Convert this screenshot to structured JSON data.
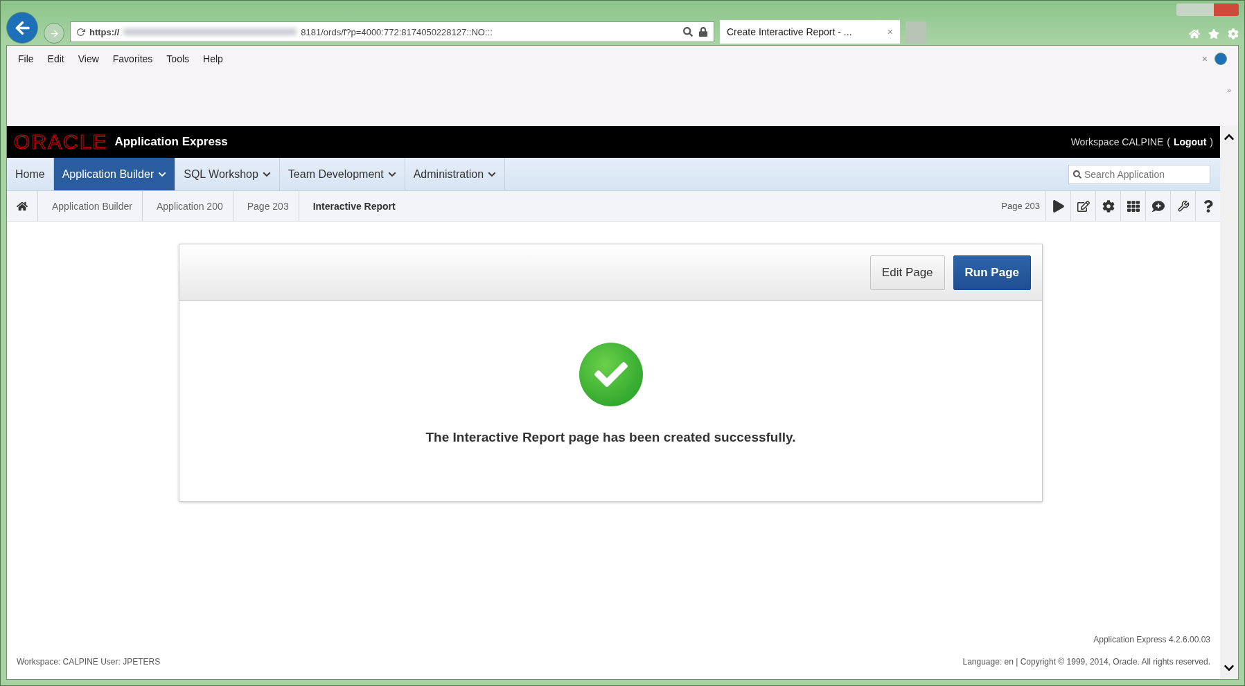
{
  "browser": {
    "url_scheme": "https://",
    "url_rest": "8181/ords/f?p=4000:772:8174050228127::NO:::",
    "tabs": [
      {
        "title": "Create Interactive Report - ...",
        "selected": true
      }
    ],
    "tab_close": "×",
    "menu": [
      "File",
      "Edit",
      "View",
      "Favorites",
      "Tools",
      "Help"
    ],
    "bar_close": "×",
    "chevron": "»"
  },
  "header": {
    "logo": "ORACLE",
    "product": "Application Express",
    "workspace": "Workspace CALPINE",
    "logout": "Logout",
    "paren_open": "(",
    "paren_close": ")"
  },
  "nav": [
    {
      "label": "Home",
      "selected": false,
      "dropdown": false
    },
    {
      "label": "Application Builder",
      "selected": true,
      "dropdown": true
    },
    {
      "label": "SQL Workshop",
      "selected": false,
      "dropdown": true
    },
    {
      "label": "Team Development",
      "selected": false,
      "dropdown": true
    },
    {
      "label": "Administration",
      "selected": false,
      "dropdown": true
    }
  ],
  "search": {
    "placeholder": "Search Application"
  },
  "breadcrumb": [
    {
      "label": "Application Builder",
      "current": false
    },
    {
      "label": "Application 200",
      "current": false
    },
    {
      "label": "Page 203",
      "current": false
    },
    {
      "label": "Interactive Report",
      "current": true
    }
  ],
  "page_label": "Page 203",
  "toolbar": [
    {
      "kind": "run"
    },
    {
      "kind": "edit"
    },
    {
      "kind": "settings"
    },
    {
      "kind": "grid"
    },
    {
      "kind": "comment"
    },
    {
      "kind": "tool"
    },
    {
      "kind": "help"
    }
  ],
  "card": {
    "buttons": [
      {
        "label": "Edit Page",
        "primary": false
      },
      {
        "label": "Run Page",
        "primary": true
      }
    ],
    "message": "The Interactive Report page has been created successfully."
  },
  "footer": {
    "version": "Application Express 4.2.6.00.03",
    "user": "Workspace: CALPINE User: JPETERS",
    "copyright": "Language: en | Copyright © 1999, 2014, Oracle. All rights reserved."
  }
}
